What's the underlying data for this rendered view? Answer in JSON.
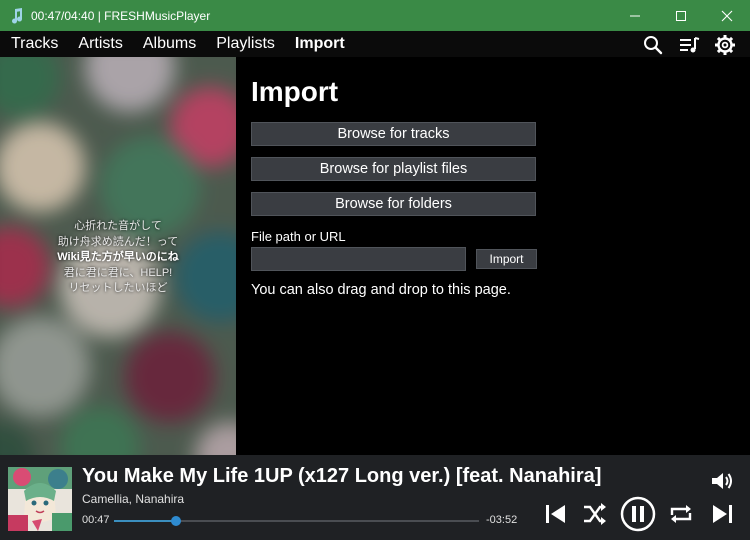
{
  "window": {
    "title": "00:47/04:40 | FRESHMusicPlayer",
    "accent": "#3a8a46"
  },
  "nav": {
    "tabs": [
      {
        "label": "Tracks",
        "active": false
      },
      {
        "label": "Artists",
        "active": false
      },
      {
        "label": "Albums",
        "active": false
      },
      {
        "label": "Playlists",
        "active": false
      },
      {
        "label": "Import",
        "active": true
      }
    ],
    "icons": [
      "search-icon",
      "queue-icon",
      "settings-icon"
    ]
  },
  "lyrics": {
    "lines": [
      "心折れた音がして",
      "助け舟求め読んだ！って",
      "Wiki見た方が早いのにね",
      "君に君に君に、HELP!",
      "リセットしたいほど"
    ],
    "current_line_index": 2
  },
  "import": {
    "heading": "Import",
    "browse_tracks_label": "Browse for tracks",
    "browse_playlists_label": "Browse for playlist files",
    "browse_folders_label": "Browse for folders",
    "path_label": "File path or URL",
    "path_value": "",
    "import_button_label": "Import",
    "drag_hint": "You can also drag and drop to this page."
  },
  "player": {
    "title": "You Make My Life 1UP (x127 Long ver.) [feat. Nanahira]",
    "artist": "Camellia, Nanahira",
    "elapsed": "00:47",
    "remaining": "-03:52",
    "progress": 0.17,
    "is_playing": true,
    "progress_color": "#3b8fbf"
  }
}
